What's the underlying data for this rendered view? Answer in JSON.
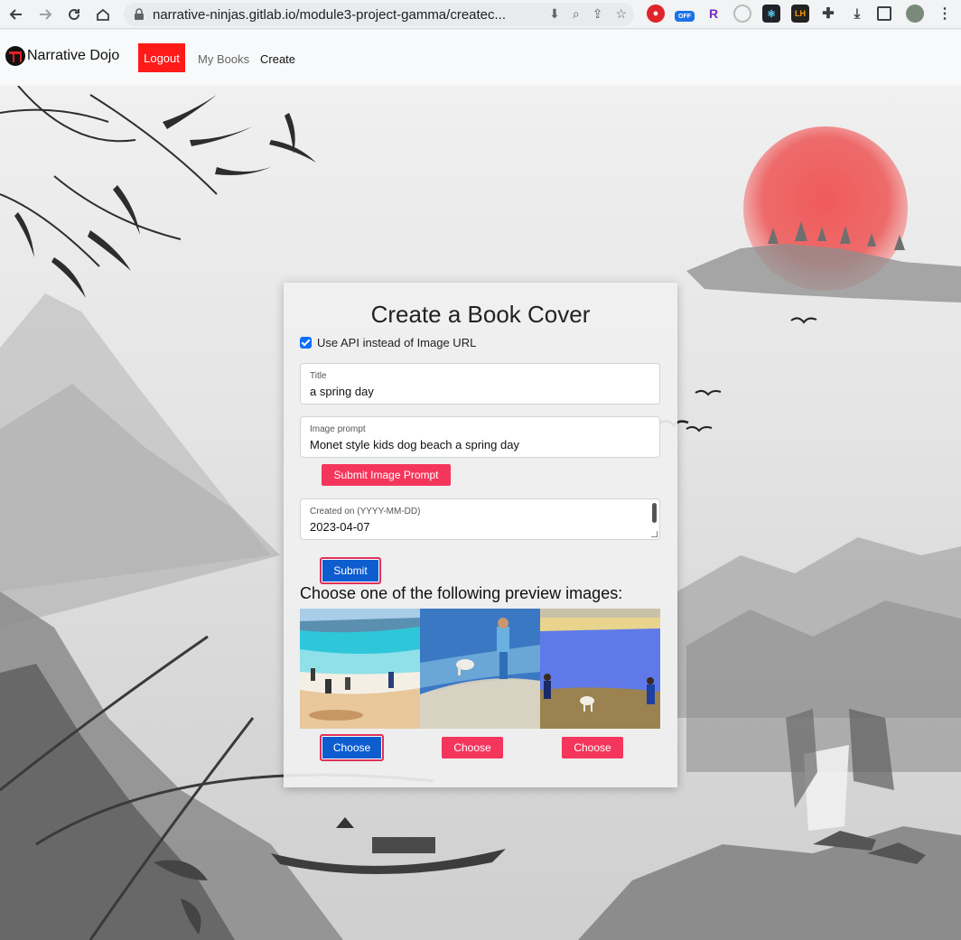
{
  "browser": {
    "url": "narrative-ninjas.gitlab.io/module3-project-gamma/createc...",
    "ext_off_label": "OFF",
    "ext_r_label": "R",
    "ext_lh_label": "LH"
  },
  "navbar": {
    "brand": "Narrative Dojo",
    "logout": "Logout",
    "links": [
      "My Books",
      "Create"
    ]
  },
  "form": {
    "title": "Create a Book Cover",
    "use_api_label": "Use API instead of Image URL",
    "use_api_checked": true,
    "title_field": {
      "label": "Title",
      "value": "a spring day"
    },
    "prompt_field": {
      "label": "Image prompt",
      "value": "Monet style kids dog beach a spring day"
    },
    "submit_prompt": "Submit Image Prompt",
    "date_field": {
      "label": "Created on (YYYY-MM-DD)",
      "value": "2023-04-07"
    },
    "submit": "Submit"
  },
  "previews": {
    "heading": "Choose one of the following preview images:",
    "choose_label": "Choose",
    "selected_index": 0
  },
  "colors": {
    "accent_pink": "#f5365c",
    "accent_blue": "#0d5dcf",
    "logout_red": "#ff1a1a"
  }
}
